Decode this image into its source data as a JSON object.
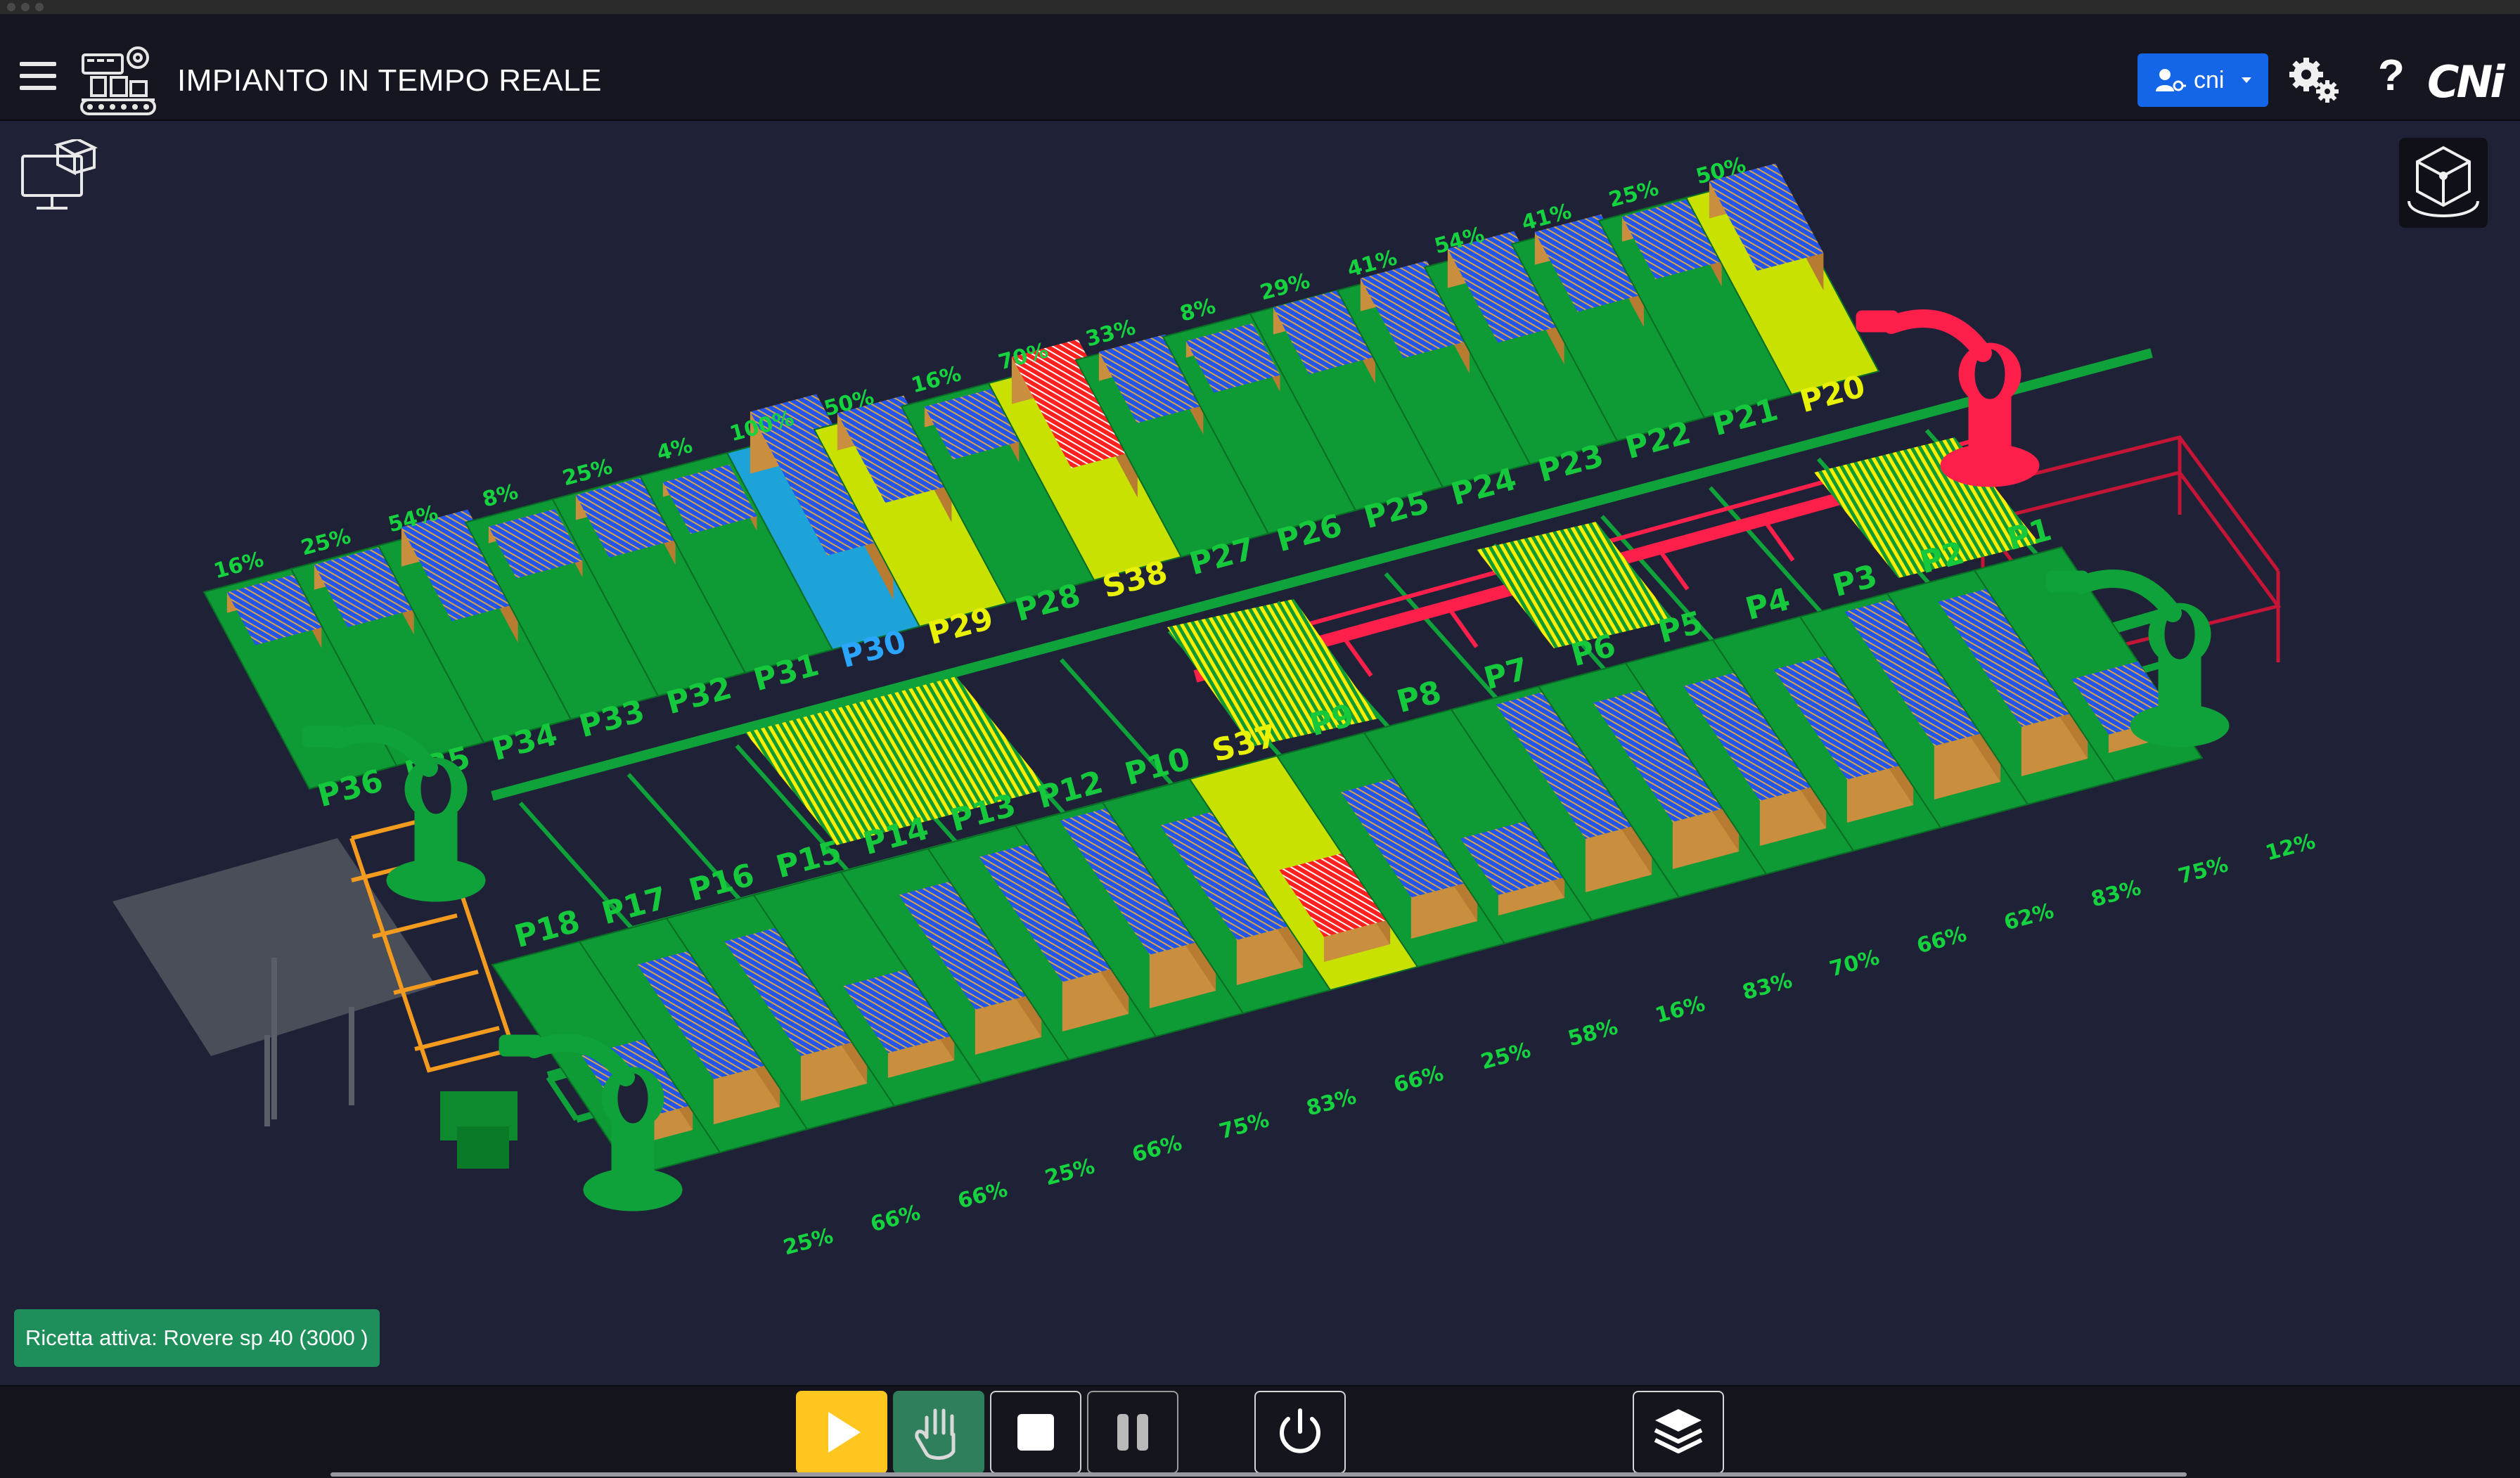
{
  "header": {
    "title": "IMPIANTO IN TEMPO REALE",
    "user_label": "cni",
    "help_label": "?",
    "brand": "CNi",
    "icons": {
      "menu": "hamburger-icon",
      "logo": "factory-plant-icon",
      "user": "user-key-icon",
      "settings": "gears-icon"
    }
  },
  "scene": {
    "view_icon": "3d-workstation-icon",
    "camera_icon": "3d-cube-view-icon",
    "bay_colors": {
      "floor": "#0e9a35",
      "selected": "#c8e100",
      "stack": "#2255e8",
      "robot_back": "#ff1f4b",
      "robot_front": "#0fa13a",
      "fence": "#f29b1e",
      "board": "#ffee00"
    },
    "top_row": [
      {
        "label": "P36",
        "percent": "16%",
        "state": "normal"
      },
      {
        "label": "P35",
        "percent": "25%",
        "state": "normal"
      },
      {
        "label": "P34",
        "percent": "54%",
        "state": "normal"
      },
      {
        "label": "P33",
        "percent": "8%",
        "state": "normal"
      },
      {
        "label": "P32",
        "percent": "25%",
        "state": "normal"
      },
      {
        "label": "P31",
        "percent": "4%",
        "state": "normal"
      },
      {
        "label": "P30",
        "percent": "100%",
        "state": "full"
      },
      {
        "label": "P29",
        "percent": "50%",
        "state": "selected"
      },
      {
        "label": "P28",
        "percent": "16%",
        "state": "normal"
      },
      {
        "label": "S38",
        "percent": "70%",
        "state": "active"
      },
      {
        "label": "P27",
        "percent": "33%",
        "state": "normal"
      },
      {
        "label": "P26",
        "percent": "8%",
        "state": "normal"
      },
      {
        "label": "P25",
        "percent": "29%",
        "state": "normal"
      },
      {
        "label": "P24",
        "percent": "41%",
        "state": "normal"
      },
      {
        "label": "P23",
        "percent": "54%",
        "state": "normal"
      },
      {
        "label": "P22",
        "percent": "41%",
        "state": "normal"
      },
      {
        "label": "P21",
        "percent": "25%",
        "state": "normal"
      },
      {
        "label": "P20",
        "percent": "50%",
        "state": "selected"
      }
    ],
    "bottom_row": [
      {
        "label": "P18",
        "percent": "25%",
        "state": "normal"
      },
      {
        "label": "P17",
        "percent": "66%",
        "state": "normal"
      },
      {
        "label": "P16",
        "percent": "66%",
        "state": "normal"
      },
      {
        "label": "P15",
        "percent": "25%",
        "state": "normal"
      },
      {
        "label": "P14",
        "percent": "66%",
        "state": "normal"
      },
      {
        "label": "P13",
        "percent": "75%",
        "state": "normal"
      },
      {
        "label": "P12",
        "percent": "83%",
        "state": "normal"
      },
      {
        "label": "P10",
        "percent": "66%",
        "state": "normal"
      },
      {
        "label": "S37",
        "percent": "25%",
        "state": "active"
      },
      {
        "label": "P9",
        "percent": "58%",
        "state": "normal"
      },
      {
        "label": "P8",
        "percent": "16%",
        "state": "normal"
      },
      {
        "label": "P7",
        "percent": "83%",
        "state": "normal"
      },
      {
        "label": "P6",
        "percent": "70%",
        "state": "normal"
      },
      {
        "label": "P5",
        "percent": "66%",
        "state": "normal"
      },
      {
        "label": "P4",
        "percent": "62%",
        "state": "normal"
      },
      {
        "label": "P3",
        "percent": "83%",
        "state": "normal"
      },
      {
        "label": "P2",
        "percent": "75%",
        "state": "normal"
      },
      {
        "label": "P1",
        "percent": "12%",
        "state": "normal"
      }
    ]
  },
  "recipe": {
    "text": "Ricetta attiva: Rovere sp 40 (3000 )"
  },
  "controls": {
    "play": "play-icon",
    "manual": "hand-icon",
    "stop": "stop-icon",
    "pause": "pause-icon",
    "power": "power-icon",
    "layers": "layers-icon"
  }
}
